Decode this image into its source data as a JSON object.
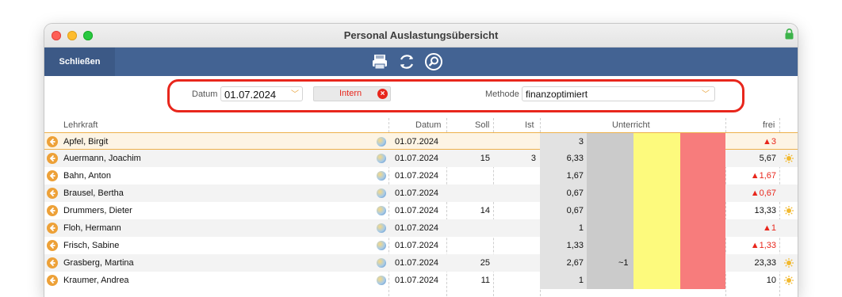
{
  "window": {
    "title": "Personal Auslastungsübersicht"
  },
  "toolbar": {
    "close_label": "Schließen",
    "icons": [
      "printer-icon",
      "refresh-icon",
      "search-icon"
    ]
  },
  "filter": {
    "datum_label": "Datum",
    "datum_value": "01.07.2024",
    "intern_label": "Intern",
    "methode_label": "Methode",
    "methode_value": "finanzoptimiert"
  },
  "columns": {
    "lehrkraft": "Lehrkraft",
    "datum": "Datum",
    "soll": "Soll",
    "ist": "Ist",
    "unterricht": "Unterricht",
    "frei": "frei"
  },
  "rows": [
    {
      "name": "Apfel, Birgit",
      "datum": "01.07.2024",
      "soll": "",
      "ist": "",
      "unterricht": "3",
      "extra": "",
      "frei": "▲3",
      "frei_negative": true,
      "sun": false
    },
    {
      "name": "Auermann, Joachim",
      "datum": "01.07.2024",
      "soll": "15",
      "ist": "3",
      "unterricht": "6,33",
      "extra": "",
      "frei": "5,67",
      "frei_negative": false,
      "sun": true
    },
    {
      "name": "Bahn, Anton",
      "datum": "01.07.2024",
      "soll": "",
      "ist": "",
      "unterricht": "1,67",
      "extra": "",
      "frei": "▲1,67",
      "frei_negative": true,
      "sun": false
    },
    {
      "name": "Brausel, Bertha",
      "datum": "01.07.2024",
      "soll": "",
      "ist": "",
      "unterricht": "0,67",
      "extra": "",
      "frei": "▲0,67",
      "frei_negative": true,
      "sun": false
    },
    {
      "name": "Drummers, Dieter",
      "datum": "01.07.2024",
      "soll": "14",
      "ist": "",
      "unterricht": "0,67",
      "extra": "",
      "frei": "13,33",
      "frei_negative": false,
      "sun": true
    },
    {
      "name": "Floh, Hermann",
      "datum": "01.07.2024",
      "soll": "",
      "ist": "",
      "unterricht": "1",
      "extra": "",
      "frei": "▲1",
      "frei_negative": true,
      "sun": false
    },
    {
      "name": "Frisch, Sabine",
      "datum": "01.07.2024",
      "soll": "",
      "ist": "",
      "unterricht": "1,33",
      "extra": "",
      "frei": "▲1,33",
      "frei_negative": true,
      "sun": false
    },
    {
      "name": "Grasberg, Martina",
      "datum": "01.07.2024",
      "soll": "25",
      "ist": "",
      "unterricht": "2,67",
      "extra": "~1",
      "frei": "23,33",
      "frei_negative": false,
      "sun": true
    },
    {
      "name": "Kraumer, Andrea",
      "datum": "01.07.2024",
      "soll": "11",
      "ist": "",
      "unterricht": "1",
      "extra": "",
      "frei": "10",
      "frei_negative": false,
      "sun": true
    }
  ],
  "colors": {
    "toolbar": "#436393",
    "highlight": "#e8261c",
    "row_arrow": "#eda138",
    "unterricht_yellow": "#fdfa7d",
    "unterricht_red": "#f77c7c"
  }
}
